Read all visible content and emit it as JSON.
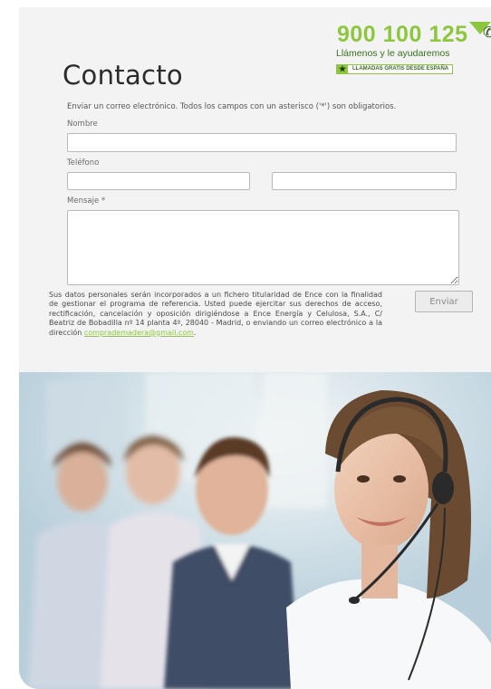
{
  "banner": {
    "phone": "900 100 125",
    "tagline": "Llámenos y le ayudaremos",
    "free_calls": "LLAMADAS GRATIS DESDE ESPAÑA",
    "icon": "phone-icon"
  },
  "form": {
    "title": "Contacto",
    "intro": "Enviar un correo electrónico. Todos los campos con un asterisco ('*') son obligatorios.",
    "fields": {
      "name_label": "Nombre",
      "name_value": "",
      "phone_label": "Teléfono",
      "phone_value": "",
      "phone2_value": "",
      "message_label": "Mensaje *",
      "message_value": ""
    },
    "legal_text": "Sus datos personales serán incorporados a un fichero titularidad de Ence con la finalidad de gestionar el programa de referencia. Usted puede ejercitar sus derechos de acceso, rectificación, cancelación y oposición dirigiéndose a Ence Energía y Celulosa, S.A., C/ Beatriz de Bobadilla nº 14 planta 4º, 28040 - Madrid, o enviando un correo electrónico a la dirección ",
    "legal_email": "comprademadera@gmail.com",
    "legal_end": ".",
    "send_label": "Enviar"
  },
  "colors": {
    "accent": "#8dc63f",
    "accent_dark": "#3b6e1f",
    "panel_bg": "#f3f3f3"
  }
}
